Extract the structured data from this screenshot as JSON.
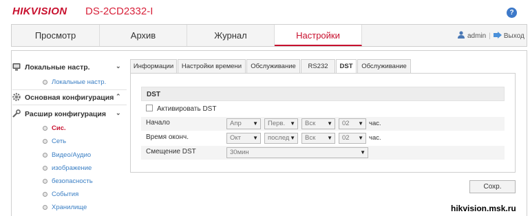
{
  "header": {
    "brand": "HIKVISION",
    "model": "DS-2CD2332-I",
    "help_label": "?"
  },
  "nav": {
    "tabs": [
      {
        "label": "Просмотр"
      },
      {
        "label": "Архив"
      },
      {
        "label": "Журнал"
      },
      {
        "label": "Настройки"
      }
    ],
    "active_tab": "Настройки",
    "user": "admin",
    "separator": "|",
    "logout": "Выход"
  },
  "sidebar": {
    "groups": [
      {
        "label": "Локальные настр.",
        "icon": "monitor-icon",
        "chevron": "⌄",
        "items": [
          {
            "label": "Локальные настр."
          }
        ]
      },
      {
        "label": "Основная конфигурация",
        "icon": "gear-icon",
        "chevron": "⌃",
        "items": []
      },
      {
        "label": "Расшир конфигурация",
        "icon": "wrench-icon",
        "chevron": "⌄",
        "items": [
          {
            "label": "Сис."
          },
          {
            "label": "Сеть"
          },
          {
            "label": "Видео/Аудио"
          },
          {
            "label": "изображение"
          },
          {
            "label": "безопасность"
          },
          {
            "label": "События"
          },
          {
            "label": "Хранилище"
          }
        ]
      }
    ],
    "active_item": "Сис."
  },
  "subtabs": [
    {
      "label": "Информации"
    },
    {
      "label": "Настройки времени"
    },
    {
      "label": "Обслуживание"
    },
    {
      "label": "RS232"
    },
    {
      "label": "DST"
    },
    {
      "label": "Обслуживание"
    }
  ],
  "active_subtab": "DST",
  "dst": {
    "section_title": "DST",
    "enable_label": "Активировать DST",
    "enable_checked": false,
    "start": {
      "label": "Начало",
      "month": "Апр",
      "week": "Перв.",
      "day": "Вск",
      "hour": "02",
      "unit": "час."
    },
    "end": {
      "label": "Время оконч.",
      "month": "Окт",
      "week": "послед",
      "day": "Вск",
      "hour": "02",
      "unit": "час."
    },
    "bias": {
      "label": "Смещение DST",
      "value": "30мин"
    }
  },
  "save_label": "Сохр.",
  "watermark": "hikvision.msk.ru",
  "colors": {
    "accent": "#c8102e",
    "link": "#3b7fc4",
    "help": "#3d79c9"
  }
}
